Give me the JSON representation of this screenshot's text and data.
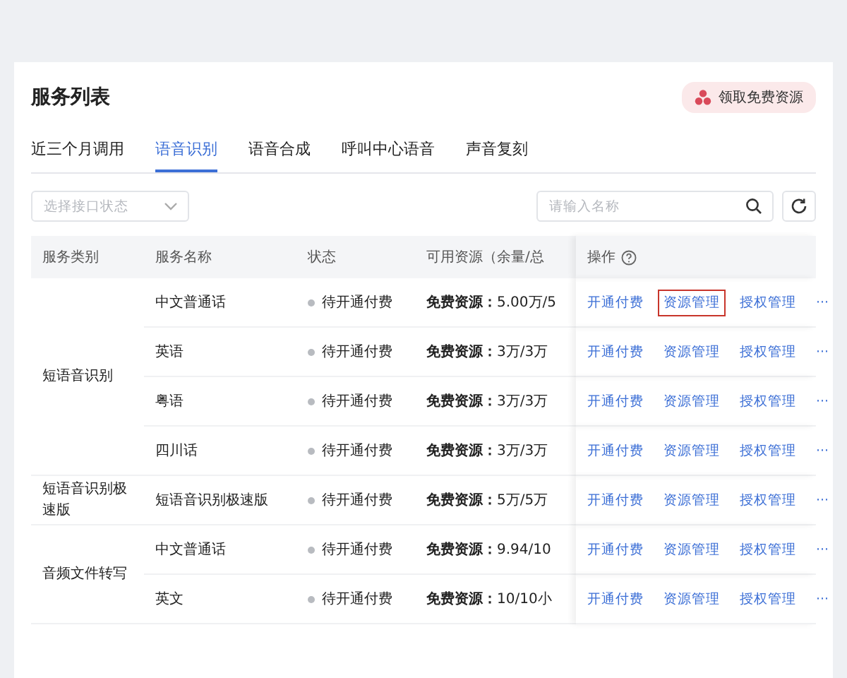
{
  "title": "服务列表",
  "promo_button": "领取免费资源",
  "tabs": [
    {
      "label": "近三个月调用",
      "selected": false
    },
    {
      "label": "语音识别",
      "selected": true
    },
    {
      "label": "语音合成",
      "selected": false
    },
    {
      "label": "呼叫中心语音",
      "selected": false
    },
    {
      "label": "声音复刻",
      "selected": false
    }
  ],
  "status_filter": {
    "placeholder": "选择接口状态"
  },
  "search": {
    "placeholder": "请输入名称"
  },
  "table": {
    "columns": [
      "服务类别",
      "服务名称",
      "状态",
      "可用资源（余量/总",
      "操作"
    ],
    "groups": [
      {
        "category": "短语音识别",
        "rows": [
          {
            "name": "中文普通话",
            "status": "待开通付费",
            "resource": "**免费资源：**5.00万/5",
            "actions": [
              {
                "label": "开通付费",
                "highlighted": false
              },
              {
                "label": "资源管理",
                "highlighted": true
              },
              {
                "label": "授权管理",
                "highlighted": false
              },
              {
                "label": "···",
                "highlighted": false
              }
            ]
          },
          {
            "name": "英语",
            "status": "待开通付费",
            "resource": "**免费资源：**3万/3万",
            "actions": [
              {
                "label": "开通付费",
                "highlighted": false
              },
              {
                "label": "资源管理",
                "highlighted": false
              },
              {
                "label": "授权管理",
                "highlighted": false
              },
              {
                "label": "···",
                "highlighted": false
              }
            ]
          },
          {
            "name": "粤语",
            "status": "待开通付费",
            "resource": "**免费资源：**3万/3万",
            "actions": [
              {
                "label": "开通付费",
                "highlighted": false
              },
              {
                "label": "资源管理",
                "highlighted": false
              },
              {
                "label": "授权管理",
                "highlighted": false
              },
              {
                "label": "···",
                "highlighted": false
              }
            ]
          },
          {
            "name": "四川话",
            "status": "待开通付费",
            "resource": "**免费资源：**3万/3万",
            "actions": [
              {
                "label": "开通付费",
                "highlighted": false
              },
              {
                "label": "资源管理",
                "highlighted": false
              },
              {
                "label": "授权管理",
                "highlighted": false
              },
              {
                "label": "···",
                "highlighted": false
              }
            ]
          }
        ]
      },
      {
        "category": "短语音识别极速版",
        "rows": [
          {
            "name": "短语音识别极速版",
            "status": "待开通付费",
            "resource": "**免费资源：**5万/5万",
            "actions": [
              {
                "label": "开通付费",
                "highlighted": false
              },
              {
                "label": "资源管理",
                "highlighted": false
              },
              {
                "label": "授权管理",
                "highlighted": false
              },
              {
                "label": "···",
                "highlighted": false
              }
            ]
          }
        ]
      },
      {
        "category": "音频文件转写",
        "rows": [
          {
            "name": "中文普通话",
            "status": "待开通付费",
            "resource": "**免费资源：**9.94/10",
            "actions": [
              {
                "label": "开通付费",
                "highlighted": false
              },
              {
                "label": "资源管理",
                "highlighted": false
              },
              {
                "label": "授权管理",
                "highlighted": false
              },
              {
                "label": "···",
                "highlighted": false
              }
            ]
          },
          {
            "name": "英文",
            "status": "待开通付费",
            "resource": "**免费资源：**10/10小",
            "actions": [
              {
                "label": "开通付费",
                "highlighted": false
              },
              {
                "label": "资源管理",
                "highlighted": false
              },
              {
                "label": "授权管理",
                "highlighted": false
              },
              {
                "label": "···",
                "highlighted": false
              }
            ]
          }
        ]
      }
    ]
  }
}
